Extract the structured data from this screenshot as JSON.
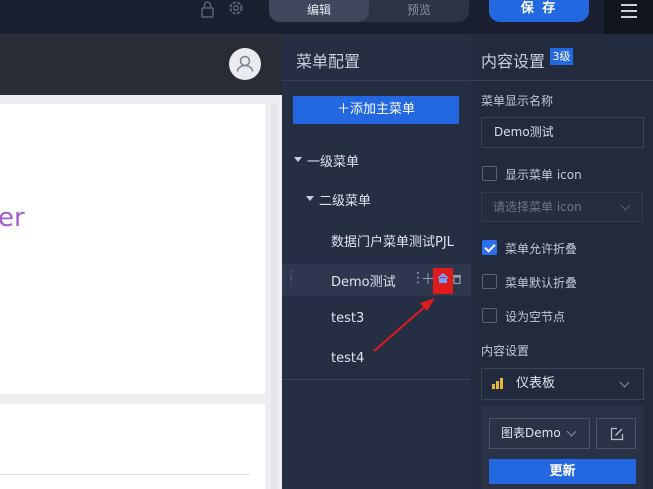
{
  "topbar": {
    "edit_label": "编辑",
    "preview_label": "预览",
    "save_label": "保 存"
  },
  "preview": {
    "partial_text": "er"
  },
  "menu_panel": {
    "title": "菜单配置",
    "add_button": "＋添加主菜单",
    "tree": {
      "level1": "一级菜单",
      "level2": "二级菜单",
      "items": [
        "数据门户菜单测试PJL",
        "Demo测试",
        "test3",
        "test4"
      ]
    }
  },
  "settings": {
    "title": "内容设置",
    "level_badge": "3级",
    "display_name_label": "菜单显示名称",
    "display_name_value": "Demo测试",
    "show_icon_label": "显示菜单 icon",
    "show_icon_checked": false,
    "icon_select_placeholder": "请选择菜单 icon",
    "allow_collapse_label": "菜单允许折叠",
    "allow_collapse_checked": true,
    "default_collapse_label": "菜单默认折叠",
    "default_collapse_checked": false,
    "empty_node_label": "设为空节点",
    "empty_node_checked": false,
    "content_label": "内容设置",
    "content_type": "仪表板",
    "chart_select": "图表Demo",
    "update_button": "更新"
  },
  "colors": {
    "accent": "#2367e1",
    "highlight": "#e01b1b",
    "bar_icon": "#e8b83a"
  }
}
